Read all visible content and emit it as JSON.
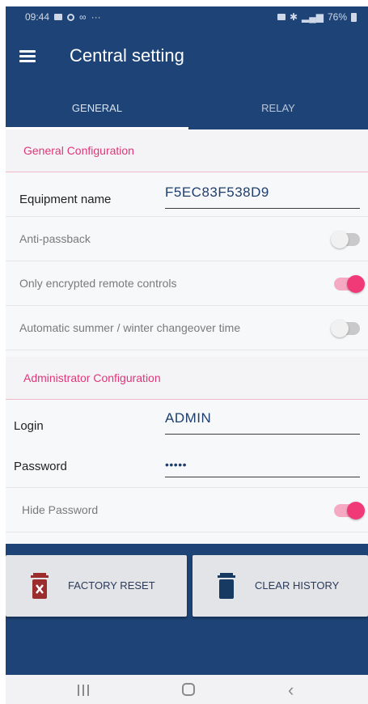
{
  "status_bar": {
    "time": "09:44",
    "battery": "76%"
  },
  "app_bar": {
    "title": "Central setting",
    "menu_icon": "hamburger-menu-icon"
  },
  "tabs": [
    {
      "label": "GENERAL",
      "active": true
    },
    {
      "label": "RELAY",
      "active": false
    }
  ],
  "general": {
    "header": "General Configuration",
    "equipment_name": {
      "label": "Equipment name",
      "value": "F5EC83F538D9"
    },
    "anti_passback": {
      "label": "Anti-passback",
      "on": false
    },
    "encrypted_remotes": {
      "label": "Only encrypted remote controls",
      "on": true
    },
    "auto_changeover": {
      "label": "Automatic summer / winter changeover time",
      "on": false
    }
  },
  "admin": {
    "header": "Administrator Configuration",
    "login": {
      "label": "Login",
      "value": "ADMIN"
    },
    "password": {
      "label": "Password",
      "value": "•••••"
    },
    "hide_password": {
      "label": "Hide Password",
      "on": true
    }
  },
  "actions": {
    "factory_reset": {
      "label": "FACTORY RESET",
      "icon": "trash-x-icon",
      "icon_color": "#9b2d2d"
    },
    "clear_history": {
      "label": "CLEAR HISTORY",
      "icon": "trash-icon",
      "icon_color": "#173a63"
    }
  },
  "colors": {
    "primary": "#1e4477",
    "accent": "#e0357a",
    "switch_on": "#f03a78"
  }
}
